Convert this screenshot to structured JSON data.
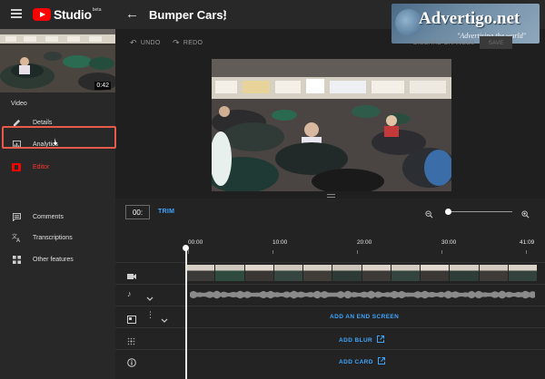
{
  "app": {
    "brand": "Studio",
    "beta_badge": "beta",
    "video_title": "Bumper Cars!"
  },
  "ad": {
    "name": "Advertigo.net",
    "tagline": "\"Advertising the world\""
  },
  "sidebar": {
    "duration": "0:42",
    "section_label": "Video",
    "items": [
      {
        "label": "Details",
        "icon": "pencil-icon"
      },
      {
        "label": "Analytics",
        "icon": "bar-chart-icon"
      },
      {
        "label": "Editor",
        "icon": "film-icon",
        "active": true
      },
      {
        "label": "Comments",
        "icon": "comment-icon"
      },
      {
        "label": "Transcriptions",
        "icon": "translate-icon"
      },
      {
        "label": "Other features",
        "icon": "grid-icon"
      }
    ]
  },
  "toolbar": {
    "undo_label": "UNDO",
    "redo_label": "REDO",
    "discard_label": "DISCARD CHANGES",
    "save_label": "SAVE"
  },
  "timeline": {
    "current_time": "00:",
    "trim_label": "TRIM",
    "zoom_level": 0.05,
    "ticks": [
      "00:00",
      "10:00",
      "20:00",
      "30:00",
      "41:09"
    ],
    "end_screen_label": "ADD AN END SCREEN",
    "blur_label": "ADD BLUR",
    "card_label": "ADD CARD"
  },
  "colors": {
    "accent": "#3ea6ff",
    "active": "#ff3434",
    "brand_red": "#ff0000",
    "highlight": "#e85a4a"
  }
}
